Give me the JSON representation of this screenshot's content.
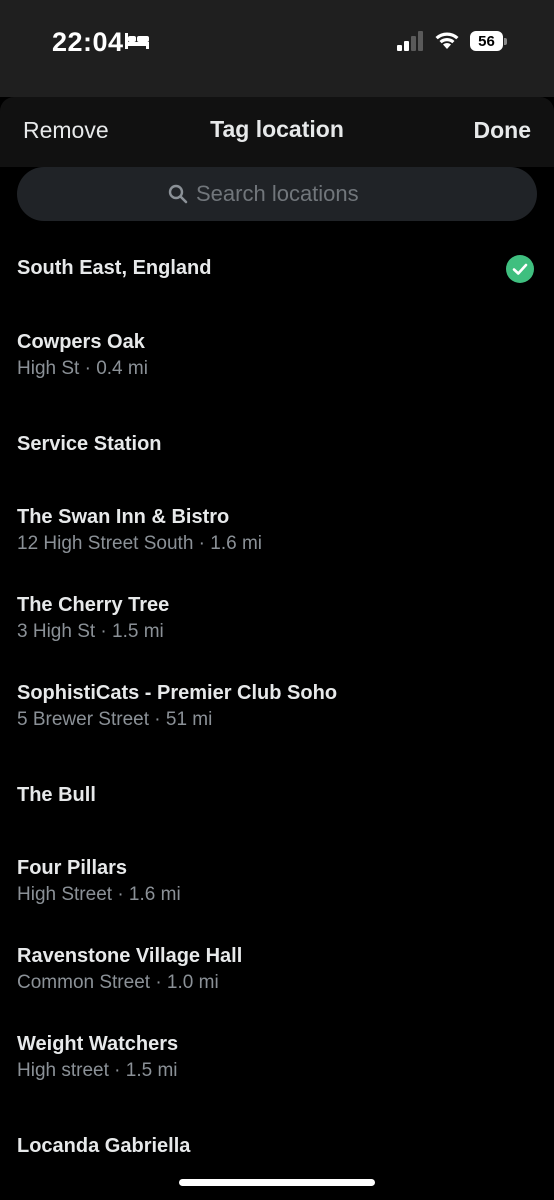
{
  "status_bar": {
    "time": "22:04",
    "battery": "56",
    "icons": [
      "bed-icon",
      "signal-icon",
      "wifi-icon",
      "battery-icon"
    ]
  },
  "header": {
    "remove_label": "Remove",
    "title": "Tag location",
    "done_label": "Done"
  },
  "search": {
    "placeholder": "Search locations"
  },
  "locations": [
    {
      "name": "South East, England",
      "detail": "",
      "selected": true
    },
    {
      "name": "Cowpers Oak",
      "detail": "High St · 0.4 mi"
    },
    {
      "name": "Service Station",
      "detail": ""
    },
    {
      "name": "The Swan Inn & Bistro",
      "detail": "12 High Street South · 1.6 mi"
    },
    {
      "name": "The Cherry Tree",
      "detail": "3 High St · 1.5 mi"
    },
    {
      "name": "SophistiCats - Premier Club Soho",
      "detail": "5 Brewer Street · 51 mi"
    },
    {
      "name": "The Bull",
      "detail": ""
    },
    {
      "name": "Four Pillars",
      "detail": "High Street · 1.6 mi"
    },
    {
      "name": "Ravenstone Village Hall",
      "detail": "Common Street · 1.0 mi"
    },
    {
      "name": "Weight Watchers",
      "detail": "High street · 1.5 mi"
    },
    {
      "name": "Locanda Gabriella",
      "detail": ""
    }
  ],
  "colors": {
    "selected_check": "#3fbf7f"
  }
}
